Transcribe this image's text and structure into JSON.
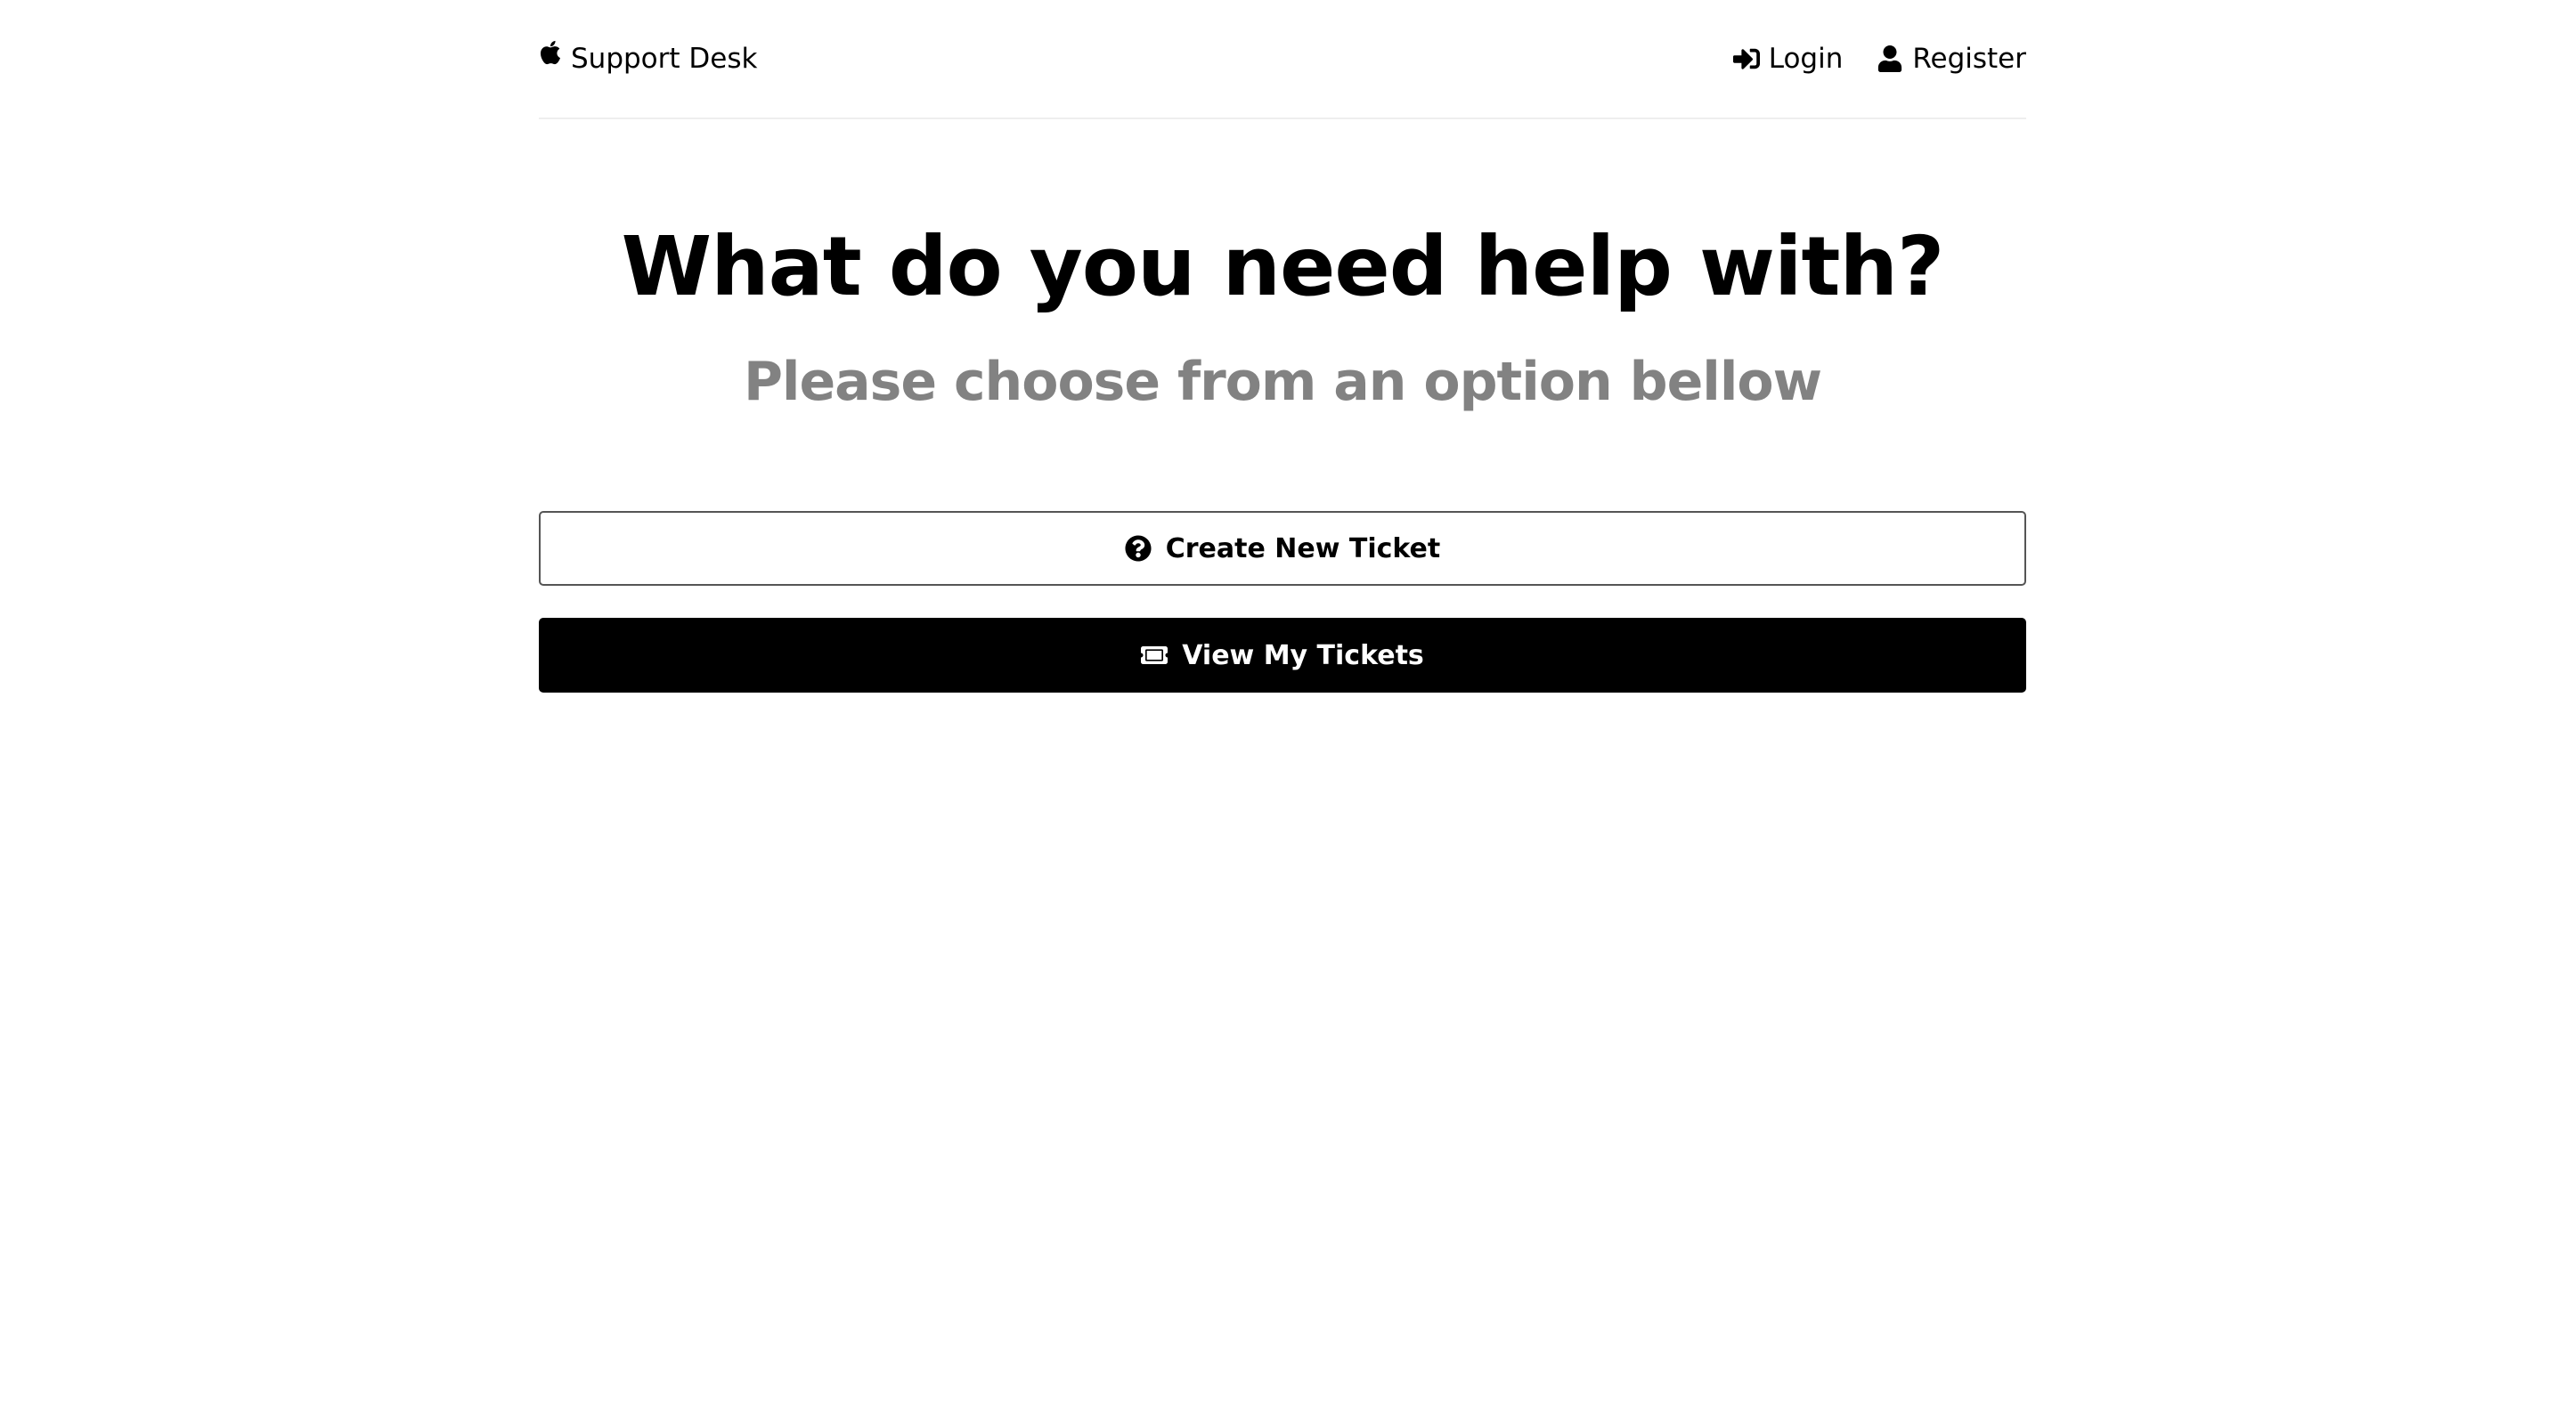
{
  "header": {
    "logo_label": "Support Desk",
    "logo_icon": "apple-icon",
    "nav": {
      "login_label": "Login",
      "login_icon": "sign-in-icon",
      "register_label": "Register",
      "register_icon": "user-icon"
    }
  },
  "main": {
    "title": "What do you need help with?",
    "subtitle": "Please choose from an option bellow",
    "buttons": {
      "create_label": "Create New Ticket",
      "create_icon": "question-circle-icon",
      "view_label": "View My Tickets",
      "view_icon": "ticket-icon"
    }
  },
  "colors": {
    "text": "#000000",
    "subtitle": "#828282",
    "background": "#ffffff",
    "divider": "#eeeeee"
  }
}
